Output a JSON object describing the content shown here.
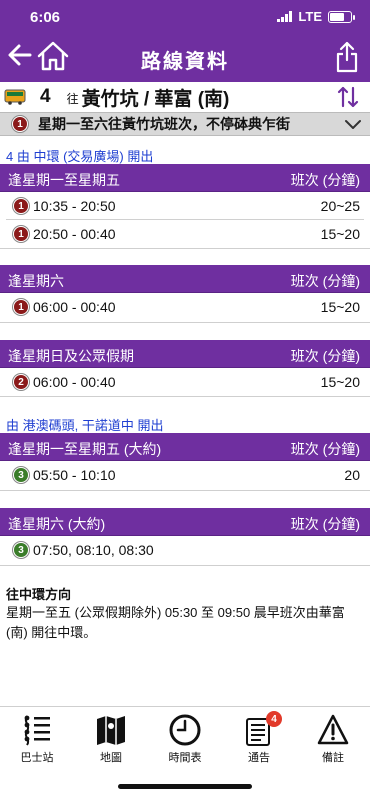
{
  "status": {
    "time": "6:06",
    "network": "LTE"
  },
  "nav": {
    "title": "路線資料"
  },
  "route": {
    "number": "4",
    "to_label": "往",
    "destination": "黃竹坑 / 華富 (南)"
  },
  "variant": {
    "badge": "1",
    "text": "星期一至六往黃竹坑班次，不停砵典乍街"
  },
  "timetable": {
    "section1_label": "4 由 中環 (交易廣場) 開出",
    "section2_label": "由 港澳碼頭, 干諾道中 開出",
    "freq_header": "班次 (分鐘)",
    "blocks": [
      {
        "title": "逢星期一至星期五",
        "rows": [
          {
            "badge": "1",
            "time": "10:35 - 20:50",
            "freq": "20~25"
          },
          {
            "badge": "1",
            "time": "20:50 - 00:40",
            "freq": "15~20"
          }
        ]
      },
      {
        "title": "逢星期六",
        "rows": [
          {
            "badge": "1",
            "time": "06:00 - 00:40",
            "freq": "15~20"
          }
        ]
      },
      {
        "title": "逢星期日及公眾假期",
        "rows": [
          {
            "badge": "2",
            "time": "06:00 - 00:40",
            "freq": "15~20"
          }
        ]
      },
      {
        "title": "逢星期一至星期五 (大約)",
        "rows": [
          {
            "badge": "3",
            "time": "05:50 - 10:10",
            "freq": "20"
          }
        ]
      },
      {
        "title": "逢星期六 (大約)",
        "rows": [
          {
            "badge": "3",
            "time": "07:50, 08:10, 08:30",
            "freq": ""
          }
        ]
      }
    ]
  },
  "note": {
    "title": "往中環方向",
    "body": "星期一至五 (公眾假期除外) 05:30 至 09:50 晨早班次由華富 (南) 開往中環。"
  },
  "tabs": [
    {
      "label": "巴士站",
      "icon": "bus-stop-list-icon"
    },
    {
      "label": "地圖",
      "icon": "map-icon"
    },
    {
      "label": "時間表",
      "icon": "clock-icon",
      "active": true
    },
    {
      "label": "通告",
      "icon": "notice-icon",
      "badge": "4"
    },
    {
      "label": "備註",
      "icon": "warning-icon"
    }
  ],
  "colors": {
    "header_purple": "#6f2fa0",
    "link_blue": "#1f3fd1",
    "badge_red": "#8b1a1a",
    "badge_green": "#3b7d2a",
    "tab_active": "#f08a1a",
    "notif_red": "#e23a2a"
  }
}
